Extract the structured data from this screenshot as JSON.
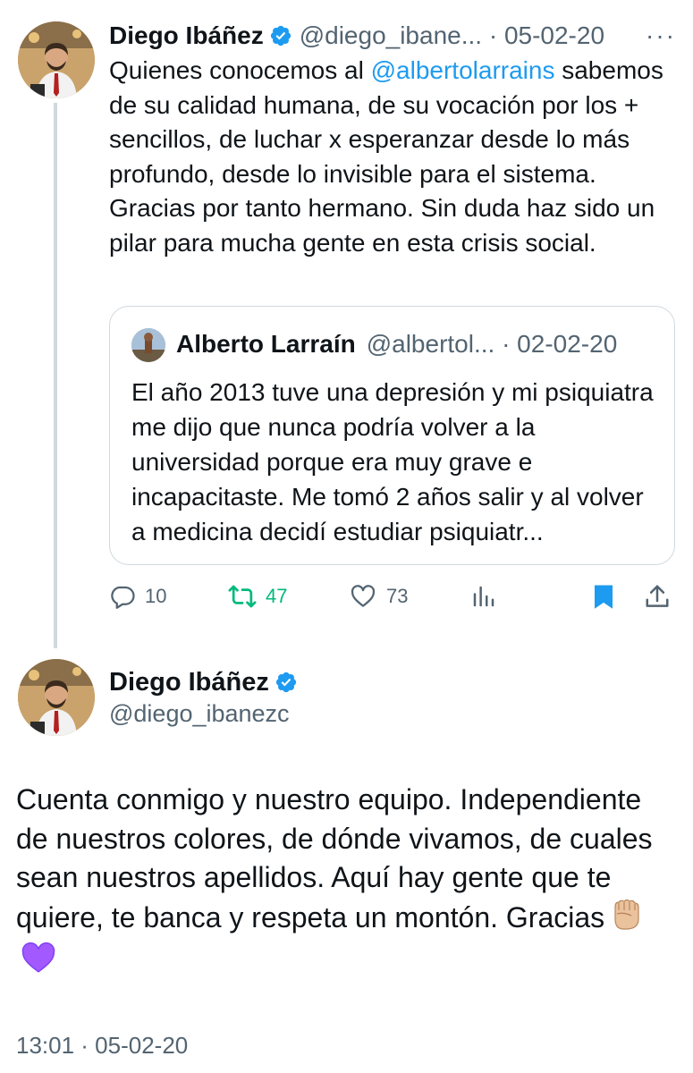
{
  "tweet": {
    "author_name": "Diego Ibáñez",
    "handle_time": "@diego_ibane... · 05-02-20",
    "more": "···",
    "text_before": "Quienes conocemos al ",
    "mention": "@albertolarrains",
    "text_after": " sabemos de su calidad humana, de su vocación por los + sencillos, de luchar x esperanzar desde lo más profundo, desde lo invisible para el sistema. Gracias por tanto hermano. Sin duda haz sido un pilar para mucha gente en esta crisis social.",
    "quote": {
      "author_name": "Alberto Larraín",
      "handle_time": "@albertol... · 02-02-20",
      "text": "El año 2013 tuve una depresión y mi psiquiatra me dijo que nunca podría volver a la universidad porque era muy grave e incapacitaste. Me tomó 2 años salir y al volver a medicina decidí estudiar psiquiatr..."
    },
    "actions": {
      "replies": "10",
      "retweets": "47",
      "likes": "73"
    }
  },
  "reply": {
    "author_name": "Diego Ibáñez",
    "handle": "@diego_ibanezc",
    "text": "Cuenta conmigo y nuestro equipo. Independiente de nuestros colores, de dónde vivamos, de cuales sean nuestros apellidos. Aquí hay gente que te quiere, te banca y respeta un montón. Gracias",
    "timestamp": "13:01 · 05-02-20"
  },
  "colors": {
    "link": "#1d9bf0",
    "retweet": "#00ba7c",
    "muted": "#536471",
    "bookmark": "#1d9bf0",
    "purple_heart": "#a259ff"
  },
  "icons": [
    "verified-badge-icon",
    "more-icon",
    "reply-icon",
    "retweet-icon",
    "like-icon",
    "views-icon",
    "bookmark-icon",
    "share-icon",
    "raised-fist-emoji",
    "purple-heart-emoji"
  ]
}
